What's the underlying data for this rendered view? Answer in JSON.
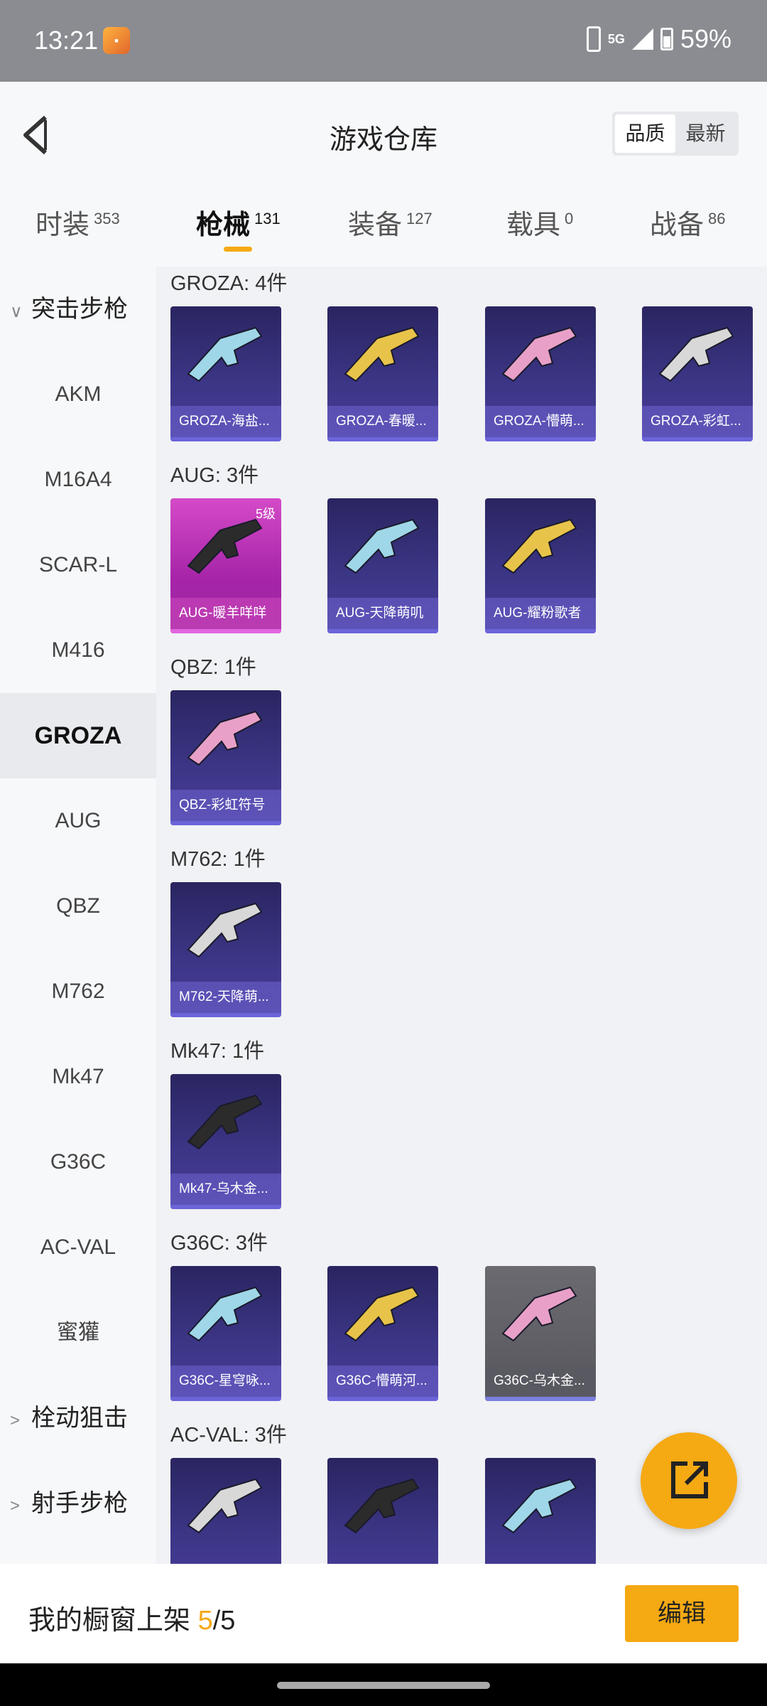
{
  "status": {
    "time": "13:21",
    "network": "5G",
    "battery": "59%"
  },
  "header": {
    "title": "游戏仓库",
    "sort": [
      "品质",
      "最新"
    ]
  },
  "tabs": [
    {
      "label": "时装",
      "count": "353"
    },
    {
      "label": "枪械",
      "count": "131"
    },
    {
      "label": "装备",
      "count": "127"
    },
    {
      "label": "载具",
      "count": "0"
    },
    {
      "label": "战备",
      "count": "86"
    }
  ],
  "sidebar": {
    "group": "突击步枪",
    "items": [
      "AKM",
      "M16A4",
      "SCAR-L",
      "M416",
      "GROZA",
      "AUG",
      "QBZ",
      "M762",
      "Mk47",
      "G36C",
      "AC-VAL",
      "蜜獾"
    ],
    "selected": "GROZA",
    "groups_collapsed": [
      "栓动狙击",
      "射手步枪"
    ]
  },
  "sections": [
    {
      "title": "GROZA: 4件",
      "items": [
        "GROZA-海盐...",
        "GROZA-春暖...",
        "GROZA-懵萌...",
        "GROZA-彩虹..."
      ]
    },
    {
      "title": "AUG: 3件",
      "items": [
        "AUG-暖羊咩咩",
        "AUG-天降萌叽",
        "AUG-耀粉歌者"
      ],
      "level_badge": "5级"
    },
    {
      "title": "QBZ: 1件",
      "items": [
        "QBZ-彩虹符号"
      ]
    },
    {
      "title": "M762: 1件",
      "items": [
        "M762-天降萌..."
      ]
    },
    {
      "title": "Mk47: 1件",
      "items": [
        "Mk47-乌木金..."
      ]
    },
    {
      "title": "G36C: 3件",
      "items": [
        "G36C-星穹咏...",
        "G36C-懵萌河...",
        "G36C-乌木金..."
      ]
    },
    {
      "title": "AC-VAL: 3件",
      "items": []
    }
  ],
  "bottom": {
    "label": "我的橱窗上架",
    "count": "5",
    "total": "/5",
    "edit": "编辑"
  },
  "colors": {
    "accent": "#f5a913",
    "card": "#3b3585",
    "card_pink": "#a624a8"
  }
}
